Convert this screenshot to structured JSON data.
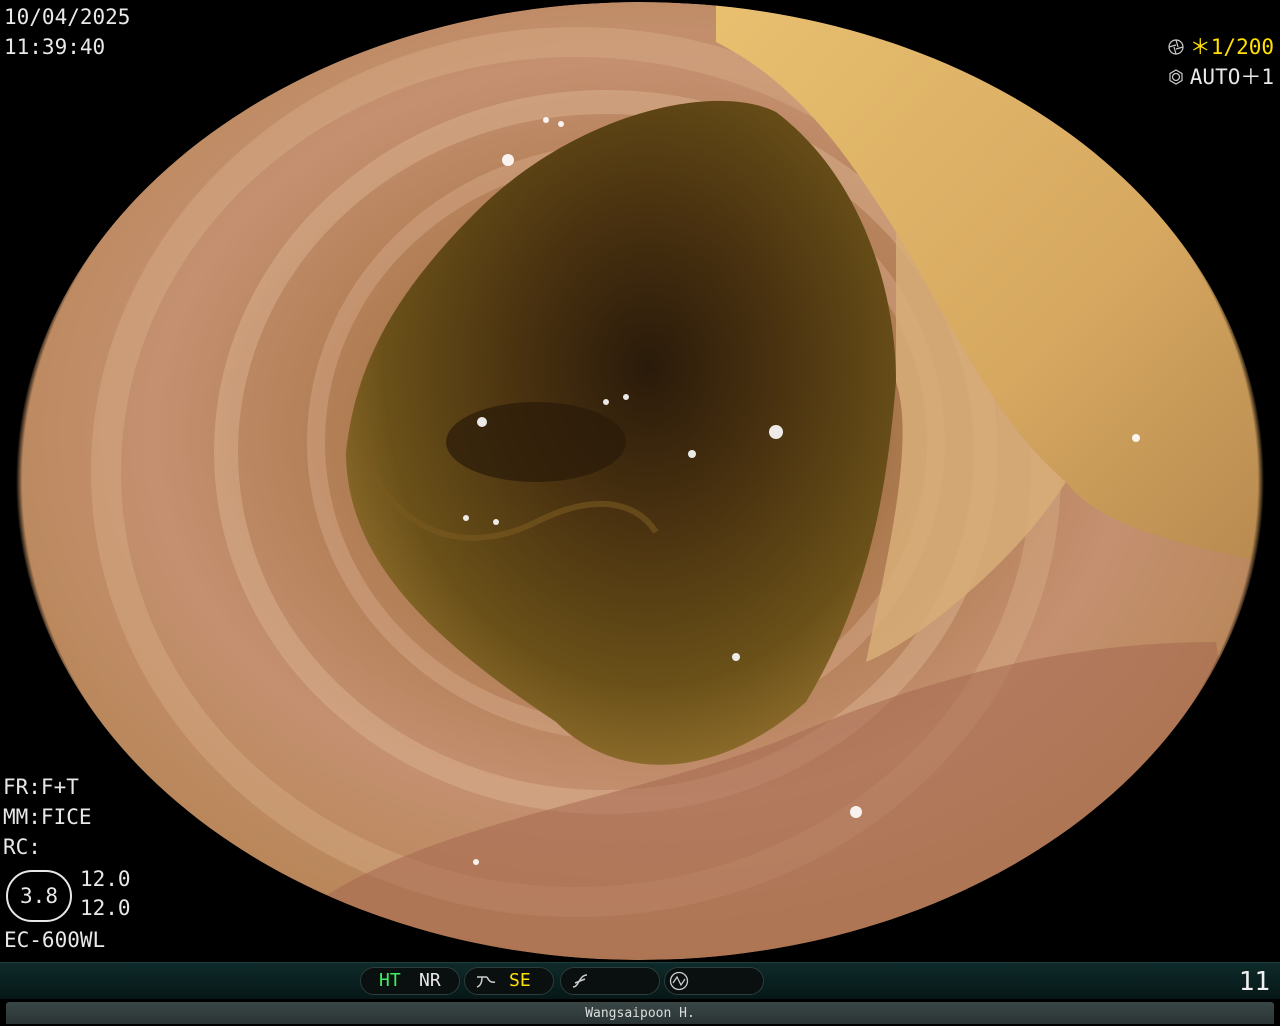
{
  "datetime": {
    "date": "10/04/2025",
    "time": "11:39:40"
  },
  "exposure": {
    "shutter": "＊1/200",
    "iris": "AUTO＋1",
    "shutter_icon": "aperture-icon",
    "iris_icon": "iris-icon"
  },
  "settings": {
    "fr": "FR:F+T",
    "mm": "MM:FICE",
    "rc": "RC:",
    "zoom": "3.8",
    "value_top": "12.0",
    "value_bottom": "12.0",
    "model": "EC-600WL"
  },
  "status_bar": {
    "ht": "HT",
    "nr": "NR",
    "se": "SE",
    "frame_count": "11"
  },
  "operator": "Wangsaipoon H.",
  "colors": {
    "accent_yellow": "#ffe000",
    "ht_green": "#3cf060"
  }
}
